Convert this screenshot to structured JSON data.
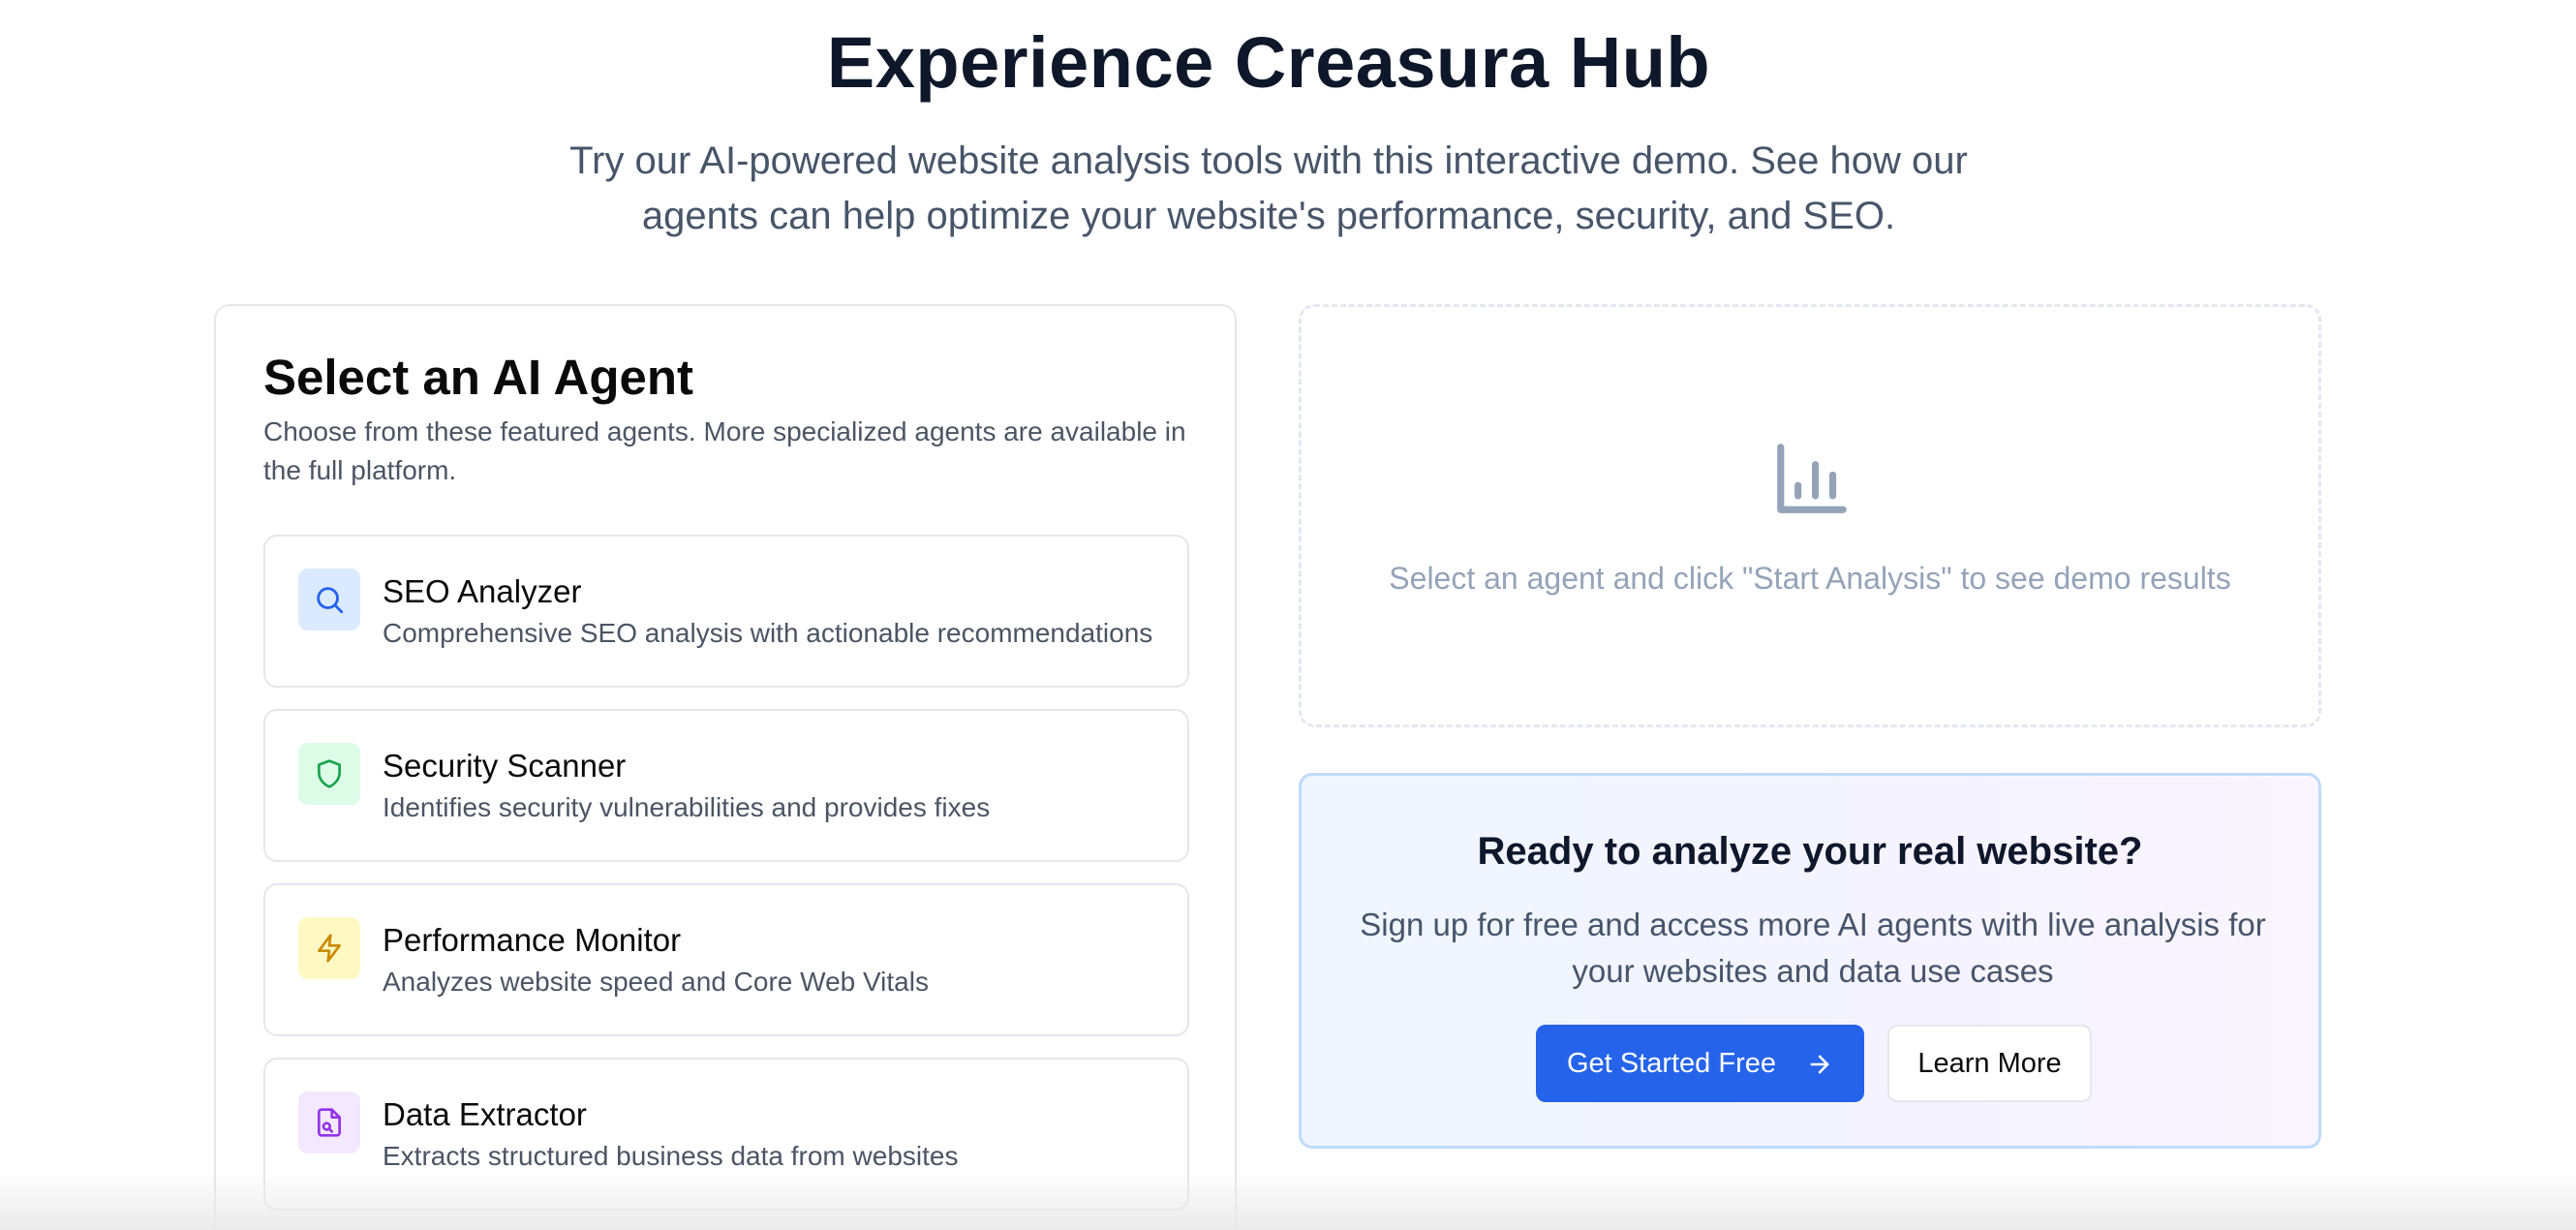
{
  "header": {
    "title": "Experience Creasura Hub",
    "subtitle_line1": "Try our AI-powered website analysis tools with this interactive demo. See how our",
    "subtitle_line2": "agents can help optimize your website's performance, security, and SEO."
  },
  "agent_panel": {
    "title": "Select an AI Agent",
    "description": "Choose from these featured agents. More specialized agents are available in the full platform.",
    "agents": [
      {
        "name": "SEO Analyzer",
        "description": "Comprehensive SEO analysis with actionable recommendations",
        "icon": "search-icon",
        "icon_bg": "#dbeafe",
        "icon_color": "#2563eb"
      },
      {
        "name": "Security Scanner",
        "description": "Identifies security vulnerabilities and provides fixes",
        "icon": "shield-icon",
        "icon_bg": "#dcfce7",
        "icon_color": "#16a34a"
      },
      {
        "name": "Performance Monitor",
        "description": "Analyzes website speed and Core Web Vitals",
        "icon": "lightning-icon",
        "icon_bg": "#fef9c3",
        "icon_color": "#ca8a04"
      },
      {
        "name": "Data Extractor",
        "description": "Extracts structured business data from websites",
        "icon": "file-search-icon",
        "icon_bg": "#f3e8ff",
        "icon_color": "#9333ea"
      }
    ]
  },
  "results": {
    "placeholder": "Select an agent and click \"Start Analysis\" to see demo results",
    "icon": "bar-chart-icon"
  },
  "cta": {
    "title": "Ready to analyze your real website?",
    "text_line1": "Sign up for free and access more AI agents with live analysis for",
    "text_line2": "your websites and data use cases",
    "primary_button": "Get Started Free",
    "secondary_button": "Learn More",
    "primary_color": "#2563eb"
  }
}
